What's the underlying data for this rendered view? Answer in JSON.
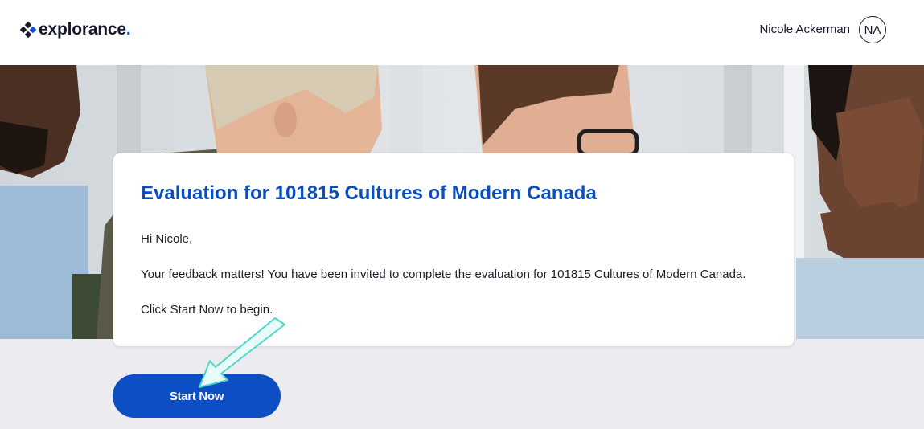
{
  "header": {
    "logo_text": "explorance",
    "logo_dot": ".",
    "user_name": "Nicole Ackerman",
    "avatar_initials": "NA"
  },
  "hero": {
    "image": "meeting-photo",
    "colors": {
      "skin_dark": "#4a2f22",
      "skin_light": "#e8b89c",
      "hair_blonde": "#d8cbb4",
      "shirt_blue": "#a9c4dd"
    }
  },
  "card": {
    "title": "Evaluation for 101815 Cultures of Modern Canada",
    "greeting": "Hi Nicole,",
    "body": "Your feedback matters! You have been invited to complete the evaluation for 101815 Cultures of Modern Canada.",
    "instruction": "Click Start Now to begin."
  },
  "actions": {
    "start_label": "Start Now"
  },
  "annotation": {
    "type": "arrow-icon",
    "color": "#5fe8dc"
  },
  "colors": {
    "accent": "#0c4ec4",
    "title": "#0b4cc0",
    "page_bg": "#ebebf0"
  }
}
